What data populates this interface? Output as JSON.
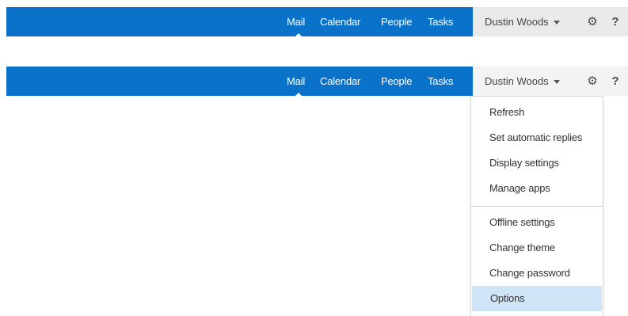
{
  "header_collapsed": {
    "nav": [
      "Mail",
      "Calendar",
      "People",
      "Tasks"
    ],
    "user_name": "Dustin Woods",
    "help_glyph": "?"
  },
  "header_expanded": {
    "nav": [
      "Mail",
      "Calendar",
      "People",
      "Tasks"
    ],
    "user_name": "Dustin Woods",
    "help_glyph": "?"
  },
  "user_menu": {
    "group1": [
      "Refresh",
      "Set automatic replies",
      "Display settings",
      "Manage apps"
    ],
    "group2": [
      "Offline settings",
      "Change theme",
      "Change password",
      "Options"
    ],
    "selected": "Options"
  },
  "colors": {
    "bar": "#0a72c9",
    "user_area": "#eaeaea",
    "selected_item": "#cfe5f7"
  },
  "icons": [
    "gear-icon",
    "help-icon",
    "chevron-down-icon"
  ]
}
